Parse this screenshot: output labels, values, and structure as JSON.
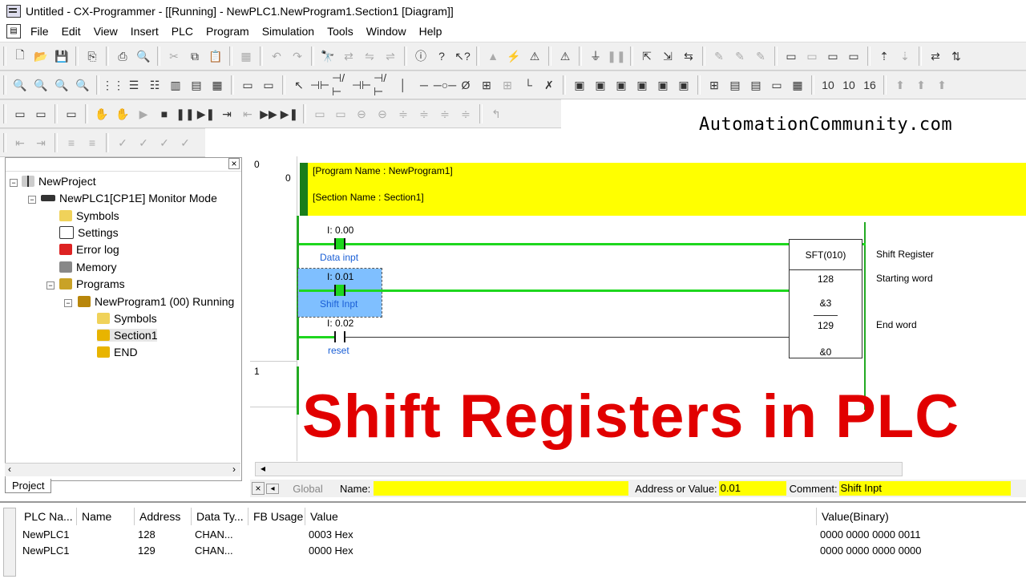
{
  "window": {
    "title": "Untitled - CX-Programmer - [[Running] - NewPLC1.NewProgram1.Section1 [Diagram]]"
  },
  "menu": [
    "File",
    "Edit",
    "View",
    "Insert",
    "PLC",
    "Program",
    "Simulation",
    "Tools",
    "Window",
    "Help"
  ],
  "watermark": "AutomationCommunity.com",
  "tree": {
    "project": "NewProject",
    "plc": "NewPLC1[CP1E] Monitor Mode",
    "symbols": "Symbols",
    "settings": "Settings",
    "errorlog": "Error log",
    "memory": "Memory",
    "programs": "Programs",
    "program": "NewProgram1 (00) Running",
    "prog_symbols": "Symbols",
    "section1": "Section1",
    "end": "END",
    "tab": "Project"
  },
  "diagram": {
    "rung0_num": "0",
    "rung0_step": "0",
    "rung1_num": "1",
    "program_name": "[Program Name : NewProgram1]",
    "section_name": "[Section Name : Section1]",
    "c1_addr": "I: 0.00",
    "c1_sym": "Data inpt",
    "c2_addr": "I: 0.01",
    "c2_sym": "Shift Inpt",
    "c3_addr": "I: 0.02",
    "c3_sym": "reset",
    "fb_name": "SFT(010)",
    "fb_op1": "128",
    "fb_op1b": "&3",
    "fb_op2": "129",
    "fb_op2b": "&0",
    "cmt1": "Shift Register",
    "cmt2": "Starting word",
    "cmt3": "End word"
  },
  "headline": "Shift Registers in PLC",
  "statusbar": {
    "global": "Global",
    "name_label": "Name:",
    "name_value": "",
    "addr_label": "Address or Value:",
    "addr_value": "0.01",
    "comment_label": "Comment:",
    "comment_value": "Shift Inpt"
  },
  "watch": {
    "headers": [
      "PLC Na...",
      "Name",
      "Address",
      "Data Ty...",
      "FB Usage",
      "Value",
      "Value(Binary)"
    ],
    "rows": [
      [
        "NewPLC1",
        "",
        "128",
        "CHAN...",
        "",
        "0003 Hex",
        "0000 0000 0000 0011"
      ],
      [
        "NewPLC1",
        "",
        "129",
        "CHAN...",
        "",
        "0000 Hex",
        "0000 0000 0000 0000"
      ]
    ]
  }
}
